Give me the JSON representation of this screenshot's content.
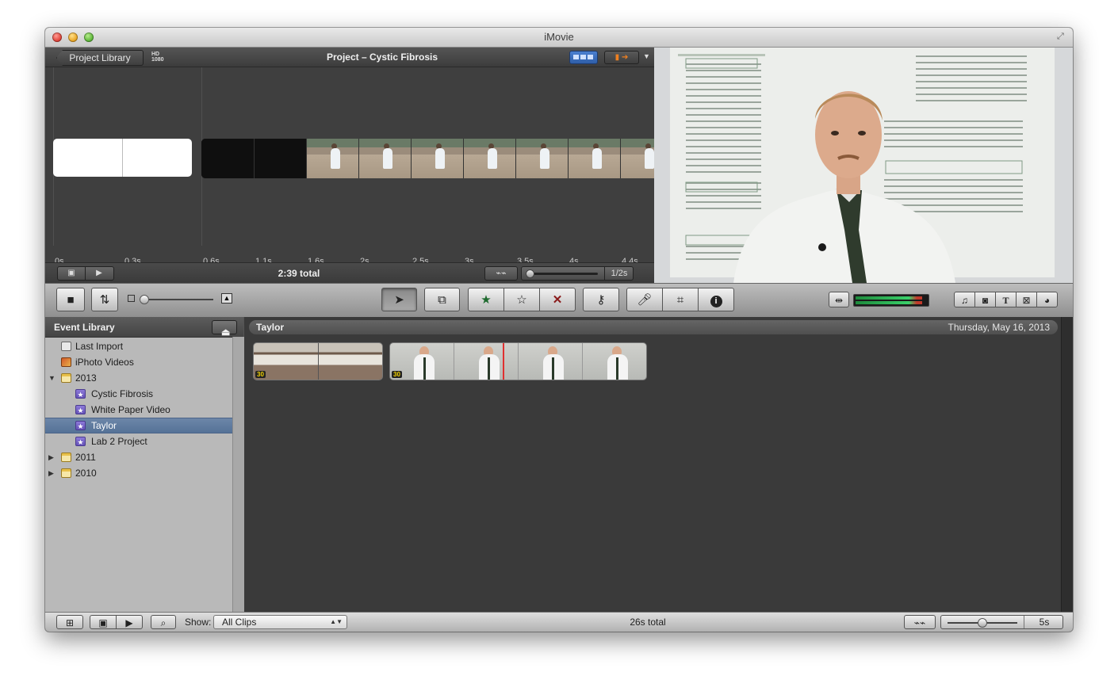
{
  "window": {
    "title": "iMovie"
  },
  "project": {
    "back_label": "Project Library",
    "hd_badge_top": "HD",
    "hd_badge_bottom": "1080",
    "title": "Project – Cystic Fibrosis",
    "ruler": [
      "0s",
      "0.3s",
      "0.6s",
      "1.1s",
      "1.6s",
      "2s",
      "2.5s",
      "3s",
      "3.5s",
      "4s",
      "4.4s"
    ],
    "total": "2:39 total",
    "zoom_label": "1/2s"
  },
  "toolbar": {
    "icons": [
      "camera-icon",
      "swap-icon",
      "thumbnail-size-slider",
      "person-icon",
      "arrow-pointer-icon",
      "add-to-project-icon",
      "favorite-star-icon",
      "unmark-star-icon",
      "reject-x-icon",
      "keyword-key-icon",
      "voiceover-mic-icon",
      "crop-icon",
      "info-icon",
      "audio-adjust-icon",
      "music-note-icon",
      "photo-camera-icon",
      "title-T-icon",
      "transition-icon",
      "map-globe-icon"
    ]
  },
  "event_library": {
    "heading": "Event Library",
    "items": [
      {
        "label": "Last Import",
        "icon": "list-icon"
      },
      {
        "label": "iPhoto Videos",
        "icon": "iphoto-icon"
      },
      {
        "label": "2013",
        "icon": "calendar-icon",
        "expanded": true
      },
      {
        "label": "Cystic Fibrosis",
        "icon": "event-star-icon"
      },
      {
        "label": "White Paper Video",
        "icon": "event-star-icon"
      },
      {
        "label": "Taylor",
        "icon": "event-star-icon",
        "selected": true
      },
      {
        "label": "Lab 2 Project",
        "icon": "event-star-icon"
      },
      {
        "label": "2011",
        "icon": "calendar-icon",
        "expanded": false
      },
      {
        "label": "2010",
        "icon": "calendar-icon",
        "expanded": false
      }
    ]
  },
  "event_browser": {
    "title": "Taylor",
    "date": "Thursday, May 16, 2013",
    "clip_badges": [
      "30",
      "30"
    ]
  },
  "bottom": {
    "show_label": "Show:",
    "show_value": "All Clips",
    "total": "26s total",
    "duration": "5s"
  },
  "colors": {
    "selection": "#557297",
    "accent_blue": "#2f5ea8",
    "reject_red": "#8a1a1a",
    "star_green": "#1e6a2e"
  }
}
